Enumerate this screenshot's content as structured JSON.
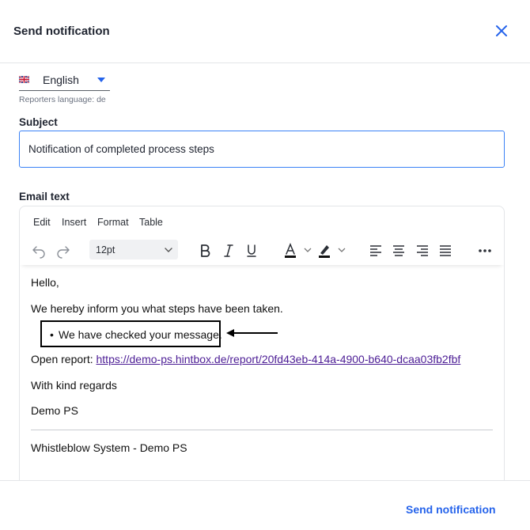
{
  "dialog": {
    "title": "Send notification",
    "close_icon": "close-icon"
  },
  "language": {
    "selected": "English",
    "flag_icon": "uk-flag-icon",
    "caret_icon": "chevron-down-icon",
    "reporters_language": "Reporters language: de"
  },
  "subject": {
    "label": "Subject",
    "value": "Notification of completed process steps"
  },
  "email": {
    "label": "Email text",
    "menu": [
      "Edit",
      "Insert",
      "Format",
      "Table"
    ],
    "toolbar": {
      "font_size": "12pt",
      "icons": [
        "undo-icon",
        "redo-icon",
        "bold-icon",
        "italic-icon",
        "underline-icon",
        "text-color-icon",
        "highlight-color-icon",
        "align-left-icon",
        "align-center-icon",
        "align-right-icon",
        "justify-icon",
        "more-icon"
      ],
      "text_color": "#111111",
      "highlight_color": "#111111"
    },
    "body": {
      "greeting": "Hello,",
      "intro": "We hereby inform you what steps have been taken.",
      "bullet": "We have checked your message.",
      "open_report_label": "Open report: ",
      "report_link": "https://demo-ps.hintbox.de/report/20fd43eb-414a-4900-b640-dcaa03fb2fbf",
      "closing": "With kind regards",
      "sender": "Demo PS",
      "signature": "Whistleblow System - Demo PS"
    }
  },
  "footer": {
    "send_label": "Send notification"
  },
  "colors": {
    "accent": "#2563eb",
    "link": "#4c1d95",
    "border": "#e3e5e8"
  }
}
